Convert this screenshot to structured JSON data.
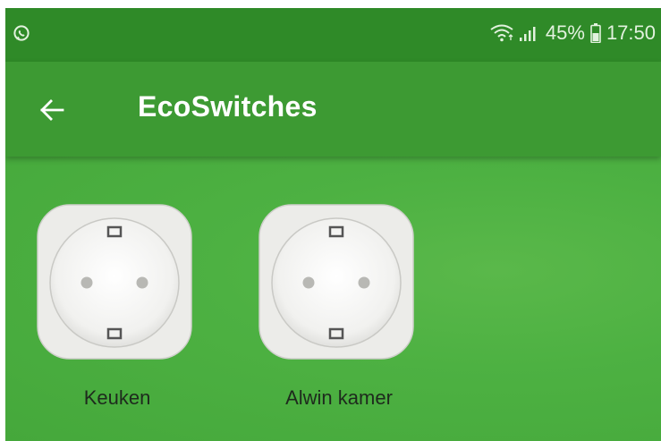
{
  "status_bar": {
    "battery": "45%",
    "time": "17:50",
    "icons": [
      "whatsapp-icon",
      "wifi-icon",
      "signal-icon",
      "battery-icon"
    ]
  },
  "app_bar": {
    "title": "EcoSwitches",
    "back_icon": "back-arrow-icon"
  },
  "devices": [
    {
      "label": "Keuken",
      "icon": "smart-plug-icon"
    },
    {
      "label": "Alwin kamer",
      "icon": "smart-plug-icon"
    }
  ],
  "colors": {
    "status_bar": "#2f8a28",
    "app_bar": "#3d9a33",
    "content": "#4db142",
    "text_on_bar": "#ffffff",
    "label_text": "#1e2a1d"
  }
}
